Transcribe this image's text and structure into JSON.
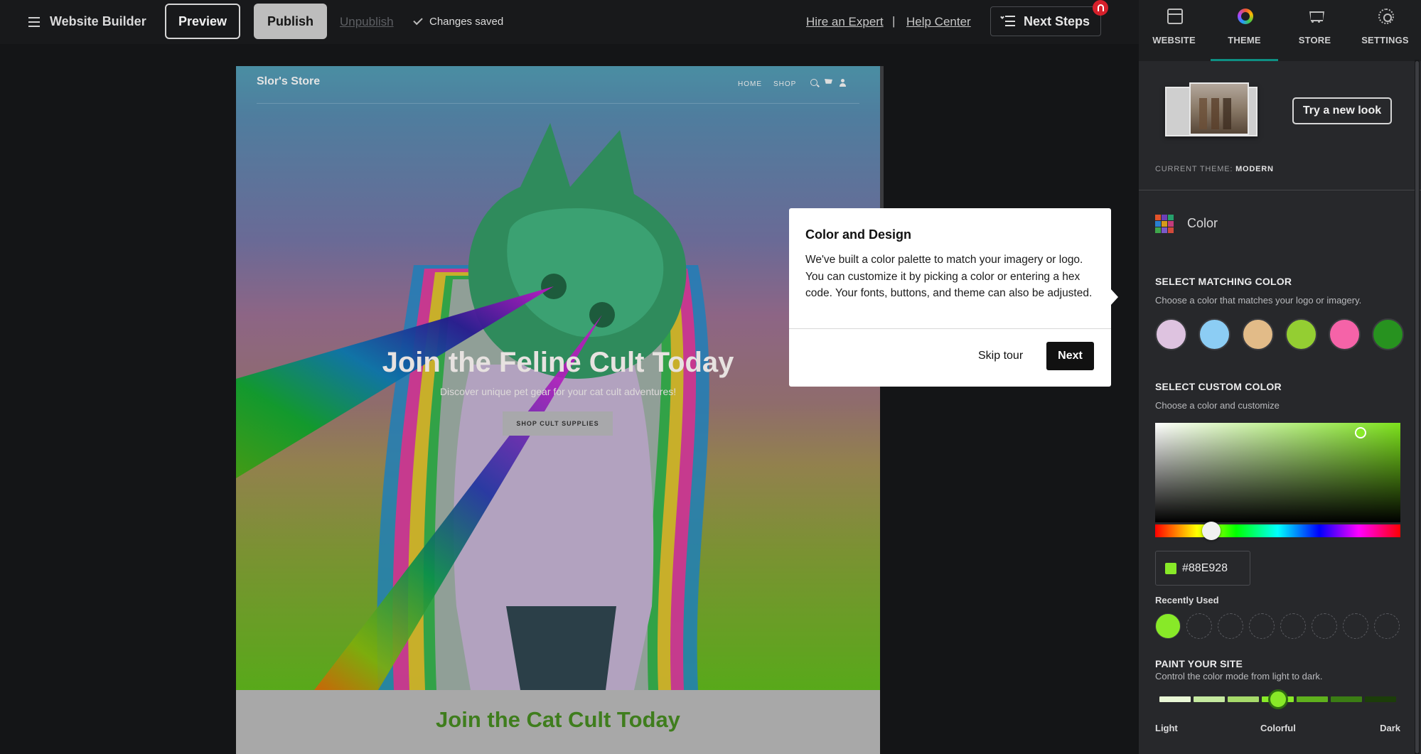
{
  "topbar": {
    "app_title": "Website Builder",
    "preview_label": "Preview",
    "publish_label": "Publish",
    "unpublish_label": "Unpublish",
    "status": "Changes saved",
    "hire_label": "Hire an Expert",
    "separator": "|",
    "help_label": "Help Center",
    "next_steps_label": "Next Steps",
    "icons": {
      "menu": "hamburger-icon",
      "status": "check-icon",
      "next_steps": "checklist-icon",
      "notification": "bell-icon"
    },
    "colors": {
      "notification_badge": "#d6202b",
      "publish_bg": "#bdbdbd"
    }
  },
  "site": {
    "logo": "Slor's Store",
    "nav": [
      "HOME",
      "SHOP"
    ],
    "nav_icons": [
      "search-icon",
      "cart-icon",
      "user-icon"
    ],
    "hero_title": "Join the Feline Cult Today",
    "hero_subtitle": "Discover unique pet gear for your cat cult adventures!",
    "hero_cta": "SHOP CULT SUPPLIES",
    "section2_title": "Join the Cat Cult Today"
  },
  "tour": {
    "title": "Color and Design",
    "body": "We've built a color palette to match your imagery or logo. You can customize it by picking a color or entering a hex code. Your fonts, buttons, and theme can also be adjusted.",
    "skip_label": "Skip tour",
    "next_label": "Next"
  },
  "panel": {
    "tabs": [
      {
        "label": "WEBSITE",
        "icon": "website-icon"
      },
      {
        "label": "THEME",
        "icon": "theme-icon",
        "active": true
      },
      {
        "label": "STORE",
        "icon": "store-icon"
      },
      {
        "label": "SETTINGS",
        "icon": "settings-icon"
      }
    ],
    "try_new_look_label": "Try a new look",
    "current_theme_prefix": "CURRENT THEME:",
    "current_theme_name": "MODERN",
    "color_section_label": "Color",
    "matching": {
      "title": "SELECT MATCHING COLOR",
      "subtitle": "Choose a color that matches your logo or imagery.",
      "swatches": [
        "#dec3e0",
        "#8ccdf4",
        "#e2bb88",
        "#94ce32",
        "#f563a8",
        "#27921f"
      ]
    },
    "custom": {
      "title": "SELECT CUSTOM COLOR",
      "subtitle": "Choose a color and customize",
      "hex": "#88E928",
      "hue_position": 0.23
    },
    "recent": {
      "title": "Recently Used",
      "colors": [
        "#88e928",
        "",
        "",
        "",
        "",
        "",
        "",
        ""
      ]
    },
    "paint": {
      "title": "PAINT YOUR SITE",
      "subtitle": "Control the color mode from light to dark.",
      "labels": {
        "light": "Light",
        "colorful": "Colorful",
        "dark": "Dark"
      },
      "level": 0.5,
      "segments": [
        "#e9f7d6",
        "#c5e9a0",
        "#a6da6a",
        "#88e928",
        "#5fb11d",
        "#3b7d14",
        "#1c3d0a"
      ]
    },
    "colors": {
      "accent": "#0e8f83",
      "selected_color": "#88e928"
    }
  }
}
